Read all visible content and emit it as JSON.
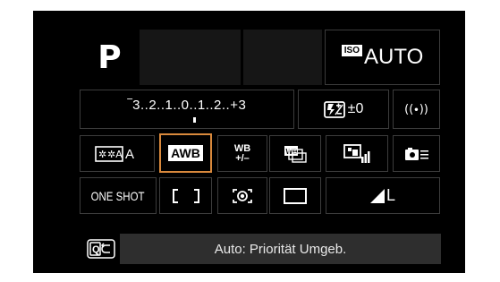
{
  "shooting_mode": "P",
  "iso": {
    "badge": "ISO",
    "value": "AUTO"
  },
  "exposure_scale": {
    "text": "‾3..2..1..0..1..2..+3"
  },
  "flash_comp": {
    "value": "±0"
  },
  "row3": {
    "wb_mode": "AWB",
    "wb_shift_top": "WB",
    "wb_shift_bottom": "+/–"
  },
  "row4": {
    "af_operation": "ONE SHOT",
    "image_quality": "L"
  },
  "status": {
    "text": "Auto: Priorität Umgeb."
  },
  "colors": {
    "selection": "#d9893c",
    "cell_border": "#3c3c3c",
    "status_bg": "#2e2e2e"
  }
}
